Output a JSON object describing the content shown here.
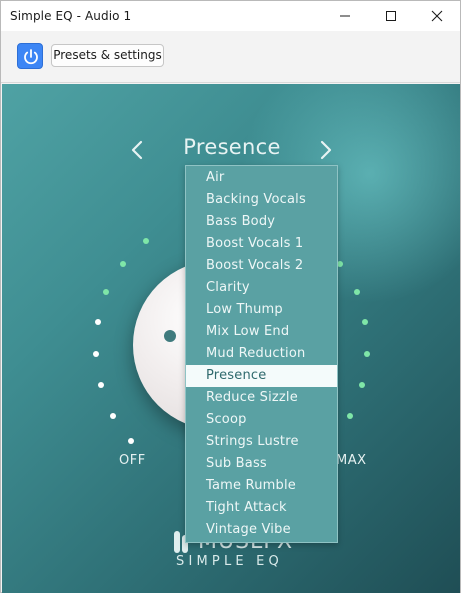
{
  "window": {
    "title": "Simple EQ - Audio 1"
  },
  "toolbar": {
    "power_icon": "power-icon",
    "presets_label": "Presets & settings"
  },
  "plugin": {
    "preset_name": "Presence",
    "knob_labels": {
      "min": "OFF",
      "max": "MAX"
    },
    "logo_text": "MUSLFX",
    "logo_subtitle": "SIMPLE EQ",
    "colors": {
      "accent_green": "#7fe6a8",
      "tick_white": "#ffffff",
      "background": "#3f8e92"
    }
  },
  "dropdown": {
    "items": [
      {
        "label": "Air",
        "selected": false
      },
      {
        "label": "Backing Vocals",
        "selected": false
      },
      {
        "label": "Bass Body",
        "selected": false
      },
      {
        "label": "Boost Vocals 1",
        "selected": false
      },
      {
        "label": "Boost Vocals 2",
        "selected": false
      },
      {
        "label": "Clarity",
        "selected": false
      },
      {
        "label": "Low Thump",
        "selected": false
      },
      {
        "label": "Mix Low End",
        "selected": false
      },
      {
        "label": "Mud Reduction",
        "selected": false
      },
      {
        "label": "Presence",
        "selected": true
      },
      {
        "label": "Reduce Sizzle",
        "selected": false
      },
      {
        "label": "Scoop",
        "selected": false
      },
      {
        "label": "Strings Lustre",
        "selected": false
      },
      {
        "label": "Sub Bass",
        "selected": false
      },
      {
        "label": "Tame Rumble",
        "selected": false
      },
      {
        "label": "Tight Attack",
        "selected": false
      },
      {
        "label": "Vintage Vibe",
        "selected": false
      }
    ]
  }
}
